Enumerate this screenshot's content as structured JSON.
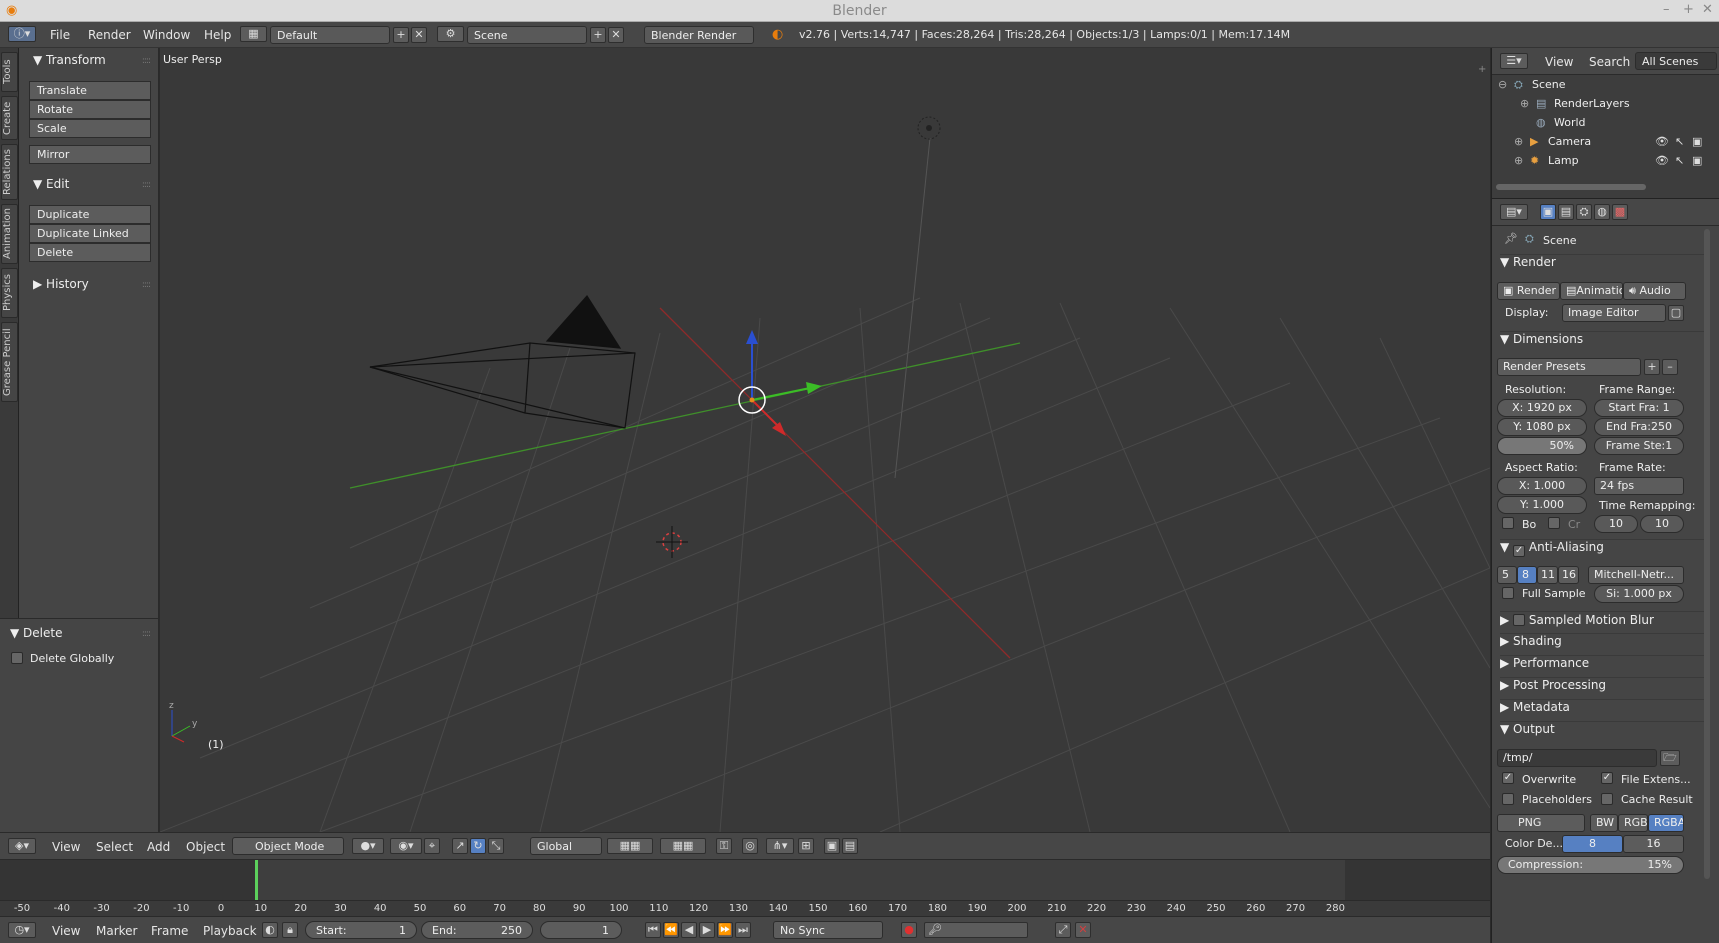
{
  "window": {
    "title": "Blender"
  },
  "info_header": {
    "menus": [
      "File",
      "Render",
      "Window",
      "Help"
    ],
    "layout": "Default",
    "scene": "Scene",
    "engine": "Blender Render",
    "stats": "v2.76 | Verts:14,747 | Faces:28,264 | Tris:28,264 | Objects:1/3 | Lamps:0/1 | Mem:17.14M"
  },
  "left_tabs": [
    "Tools",
    "Create",
    "Relations",
    "Animation",
    "Physics",
    "Grease Pencil"
  ],
  "tool_panel": {
    "transform_title": "Transform",
    "transform_buttons": [
      "Translate",
      "Rotate",
      "Scale"
    ],
    "mirror": "Mirror",
    "edit_title": "Edit",
    "edit_buttons": [
      "Duplicate",
      "Duplicate Linked",
      "Delete"
    ],
    "history_title": "History"
  },
  "operator_panel": {
    "title": "Delete",
    "option": "Delete Globally"
  },
  "viewport": {
    "view_label": "User Persp",
    "frame_label": "(1)"
  },
  "view3d_header": {
    "menus": [
      "View",
      "Select",
      "Add",
      "Object"
    ],
    "mode": "Object Mode",
    "orientation": "Global"
  },
  "timeline": {
    "ticks": [
      "-50",
      "-40",
      "-30",
      "-20",
      "-10",
      "0",
      "10",
      "20",
      "30",
      "40",
      "50",
      "60",
      "70",
      "80",
      "90",
      "100",
      "110",
      "120",
      "130",
      "140",
      "150",
      "160",
      "170",
      "180",
      "190",
      "200",
      "210",
      "220",
      "230",
      "240",
      "250",
      "260",
      "270",
      "280"
    ]
  },
  "timeline_header": {
    "menus": [
      "View",
      "Marker",
      "Frame",
      "Playback"
    ],
    "start_label": "Start:",
    "start_value": "1",
    "end_label": "End:",
    "end_value": "250",
    "current": "1",
    "sync": "No Sync"
  },
  "outliner": {
    "menus": [
      "View",
      "Search"
    ],
    "filter": "All Scenes",
    "items": [
      "Scene",
      "RenderLayers",
      "World",
      "Camera",
      "Lamp"
    ]
  },
  "properties": {
    "context": "Scene",
    "render": {
      "title": "Render",
      "buttons": [
        "Render",
        "Animatio",
        "Audio"
      ],
      "display_label": "Display:",
      "display_value": "Image Editor"
    },
    "dimensions": {
      "title": "Dimensions",
      "presets": "Render Presets",
      "resolution_label": "Resolution:",
      "res_x": "X:  1920 px",
      "res_y": "Y:  1080 px",
      "res_pct": "50%",
      "frame_range_label": "Frame Range:",
      "start": "Start Fra:   1",
      "end": "End Fra:250",
      "step": "Frame Ste:1",
      "aspect_label": "Aspect Ratio:",
      "asp_x": "X:     1.000",
      "asp_y": "Y:     1.000",
      "frame_rate_label": "Frame Rate:",
      "fps": "24 fps",
      "remap_label": "Time Remapping:",
      "remap_old": "10",
      "remap_new": "10",
      "border": "Bo",
      "crop": "Cr"
    },
    "anti_aliasing": {
      "title": "Anti-Aliasing",
      "samples": [
        "5",
        "8",
        "11",
        "16"
      ],
      "filter": "Mitchell-Netr...",
      "full_sample": "Full Sample",
      "size": "Si: 1.000 px"
    },
    "collapsed": [
      "Sampled Motion Blur",
      "Shading",
      "Performance",
      "Post Processing",
      "Metadata"
    ],
    "output": {
      "title": "Output",
      "path": "/tmp/",
      "overwrite": "Overwrite",
      "file_ext": "File Extens...",
      "placeholders": "Placeholders",
      "cache": "Cache Result",
      "format": "PNG",
      "color_modes": [
        "BW",
        "RGB",
        "RGBA"
      ],
      "depth_label": "Color De...",
      "depths": [
        "8",
        "16"
      ],
      "compression": "Compression:",
      "compression_value": "15%"
    }
  }
}
